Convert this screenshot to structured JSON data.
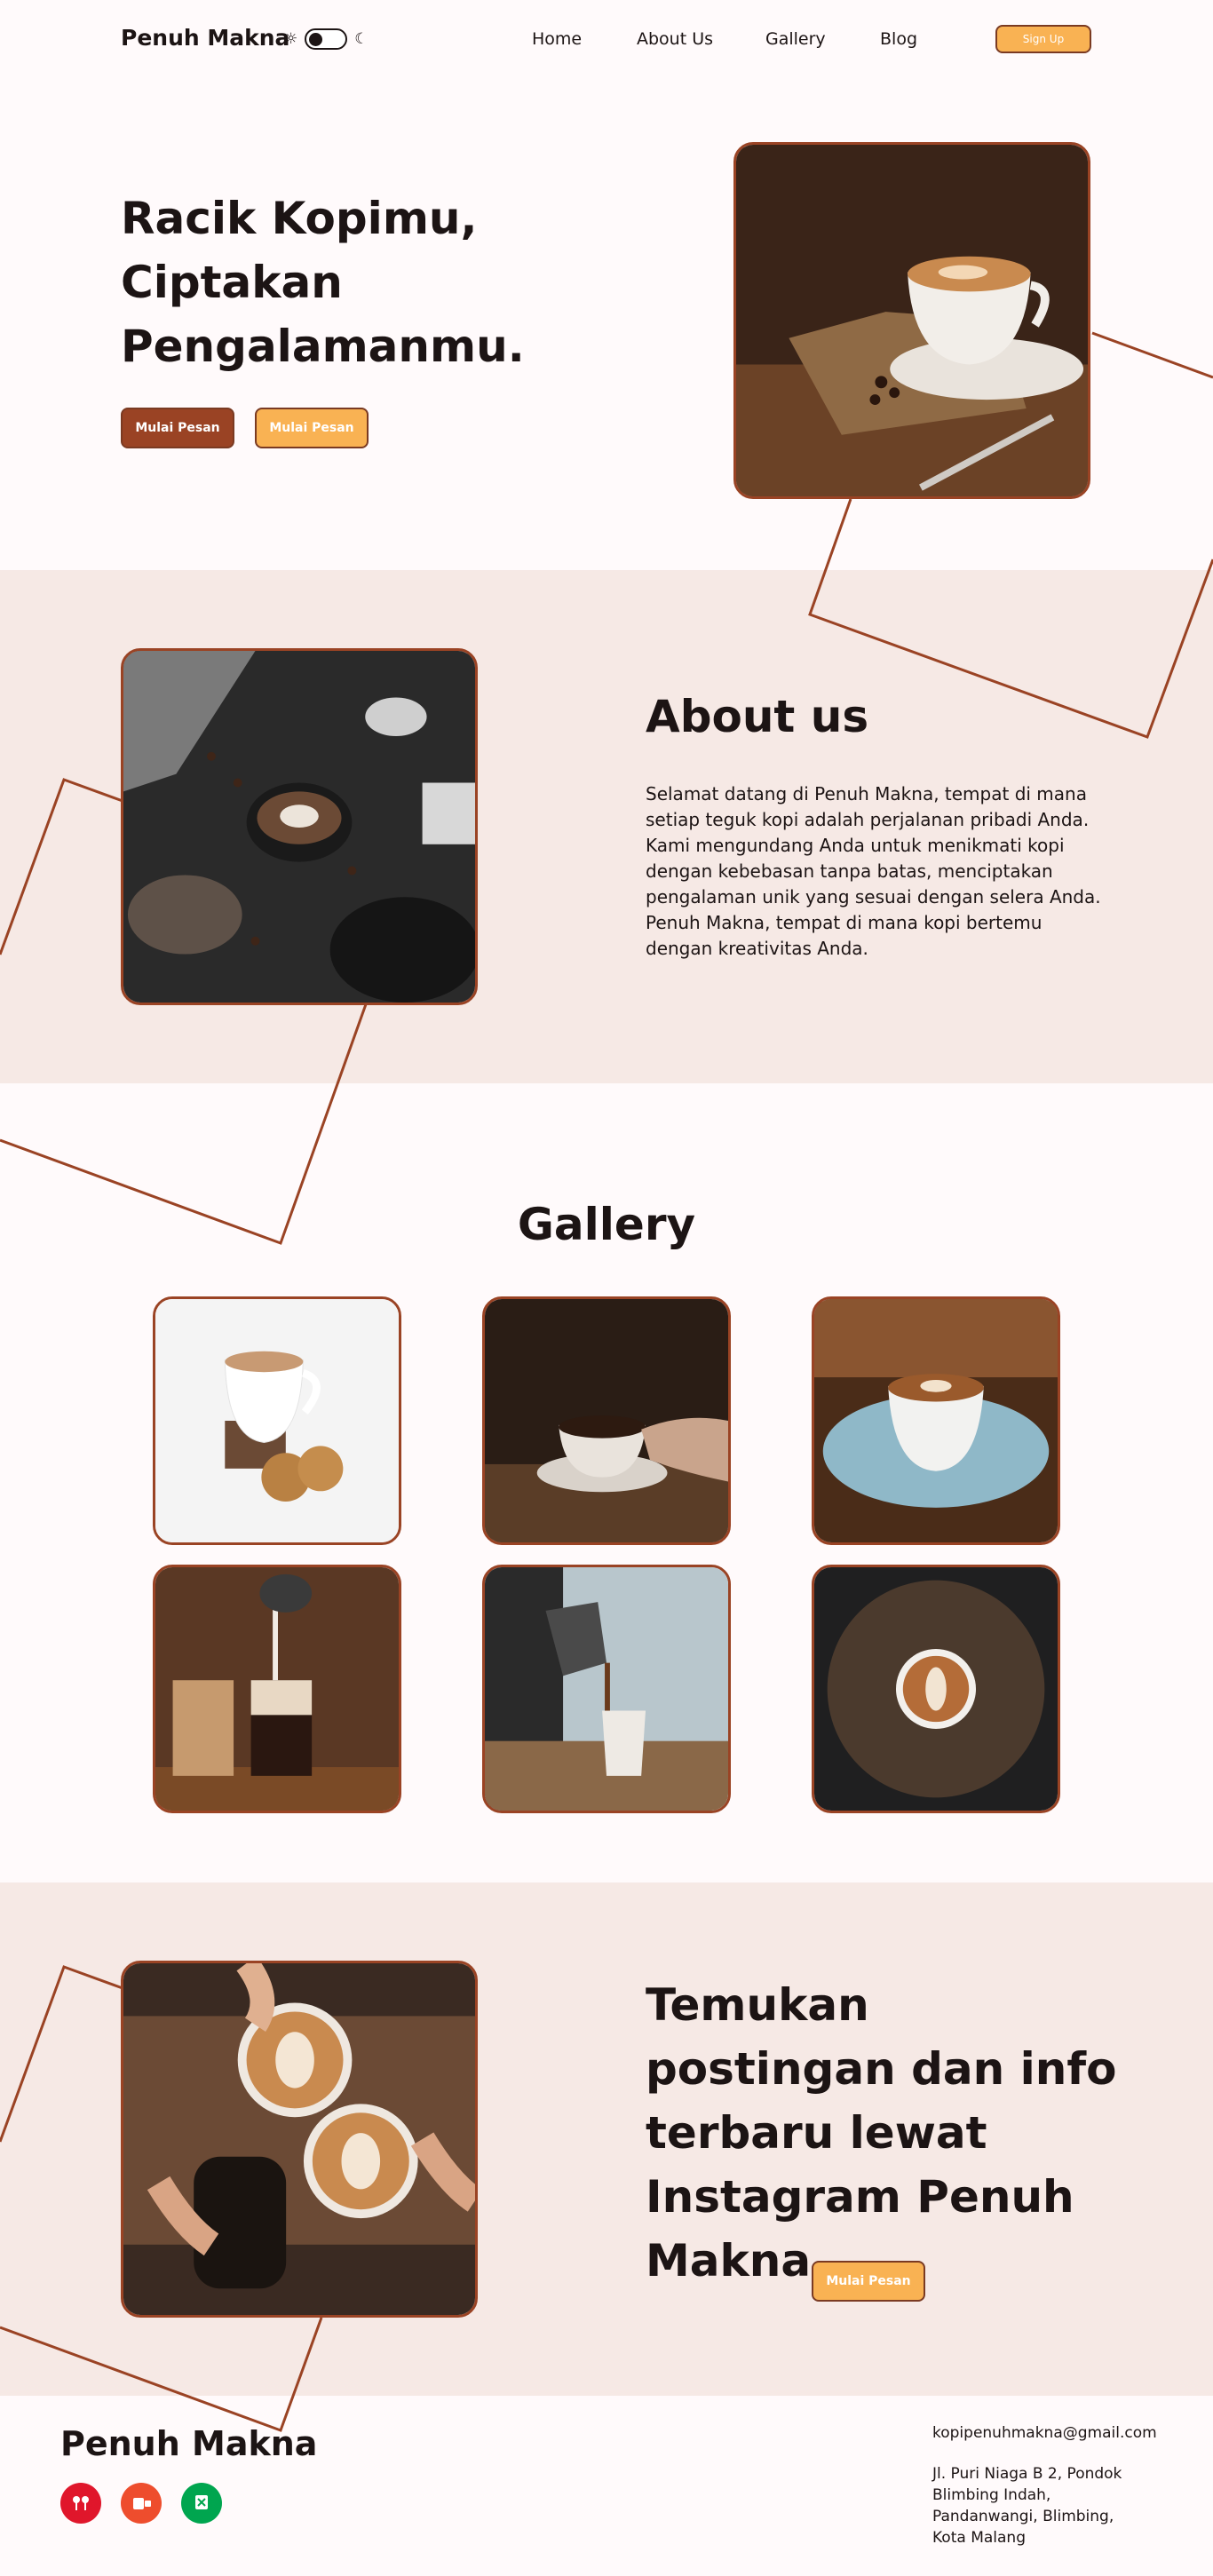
{
  "header": {
    "brand": "Penuh Makna",
    "nav": [
      "Home",
      "About Us",
      "Gallery",
      "Blog"
    ],
    "signup_label": "Sign Up",
    "theme_toggle": {
      "light_icon": "sun-icon",
      "dark_icon": "moon-icon"
    }
  },
  "hero": {
    "title": "Racik Kopimu, Ciptakan Pengalamanmu.",
    "primary_button": "Mulai Pesan",
    "secondary_button": "Mulai Pesan",
    "image": "coffee cup on saucer with beans and spoon"
  },
  "about": {
    "title": "About us",
    "text": "Selamat datang di Penuh Makna, tempat di mana setiap teguk kopi adalah perjalanan pribadi Anda. Kami mengundang Anda untuk menikmati kopi dengan kebebasan tanpa batas, menciptakan pengalaman unik yang sesuai dengan selera Anda. Penuh Makna, tempat di mana kopi bertemu dengan kreativitas Anda.",
    "image": "latte on dark table with coffee beans"
  },
  "gallery": {
    "title": "Gallery",
    "images": [
      "coffee mug with cookies",
      "hand holding coffee cup",
      "espresso on blue saucer",
      "iced coffee pour",
      "pour over coffee",
      "latte art on wooden board"
    ]
  },
  "instagram": {
    "title": "Temukan postingan dan info terbaru lewat Instagram Penuh Makna",
    "button": "Mulai Pesan",
    "image": "hands toasting latte cups"
  },
  "footer": {
    "brand": "Penuh Makna",
    "apps": [
      "gofood",
      "shopee food",
      "grabfood"
    ],
    "email": "kopipenuhmakna@gmail.com",
    "address": "Jl. Puri Niaga B 2, Pondok Blimbing Indah, Pandanwangi, Blimbing, Kota Malang"
  },
  "colors": {
    "accent": "#9a4324",
    "button_yellow": "#f9b253",
    "band": "#f6e9e5",
    "background": "#fffafb"
  }
}
